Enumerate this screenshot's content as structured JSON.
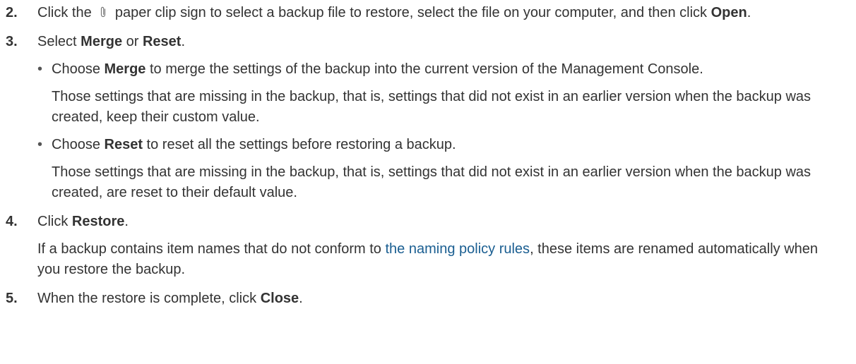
{
  "steps": [
    {
      "number": "2.",
      "text_before_icon": "Click the",
      "icon": "paperclip-icon",
      "text_after_icon": "paper clip sign to select a backup file to restore, select the file on your computer, and then click",
      "bold": "Open",
      "end": "."
    },
    {
      "number": "3.",
      "prefix": "Select",
      "bold1": "Merge",
      "middle": "or",
      "bold2": "Reset",
      "end": ".",
      "options": [
        {
          "prefix": "Choose",
          "bold": "Merge",
          "text": "to merge the settings of the backup into the current version of the Management Console.",
          "note": "Those settings that are missing in the backup, that is, settings that did not exist in an earlier version when the backup was created, keep their custom value."
        },
        {
          "prefix": "Choose",
          "bold": "Reset",
          "text": "to reset all the settings before restoring a backup.",
          "note": "Those settings that are missing in the backup, that is, settings that did not exist in an earlier version when the backup was created, are reset to their default value."
        }
      ]
    },
    {
      "number": "4.",
      "prefix": "Click",
      "bold": "Restore",
      "end": ".",
      "note_before_link": "If a backup contains item names that do not conform to",
      "link_text": "the naming policy rules",
      "note_after_link": ", these items are renamed automatically when you restore the backup."
    },
    {
      "number": "5.",
      "prefix": "When the restore is complete, click",
      "bold": "Close",
      "end": "."
    }
  ],
  "bullet_char": "•",
  "colors": {
    "text": "#333333",
    "link": "#1a5e91"
  }
}
